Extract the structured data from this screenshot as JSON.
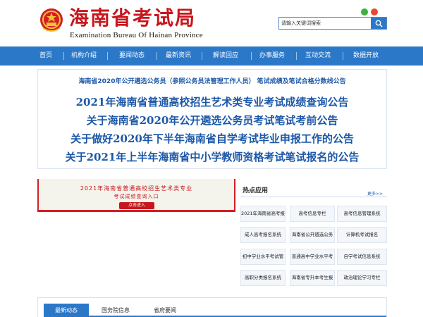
{
  "header": {
    "title": "海南省考试局",
    "subtitle": "Examination Bureau Of Hainan Province",
    "top_links": [
      "",
      ""
    ],
    "search": {
      "placeholder": "请输入关键词搜索"
    }
  },
  "nav": {
    "items": [
      {
        "label": "首页"
      },
      {
        "label": "机构介绍"
      },
      {
        "label": "要闻动态"
      },
      {
        "label": "最新资讯"
      },
      {
        "label": "解读回应"
      },
      {
        "label": "办事服务"
      },
      {
        "label": "互动交流"
      },
      {
        "label": "数据开放"
      }
    ]
  },
  "headlines": {
    "sub": "海南省2020年公开遴选公务员（参照公务员法管理工作人员） 笔试成绩及笔试合格分数线公告",
    "items": [
      {
        "text": "2021年海南省普通高校招生艺术类专业考试成绩查询公告"
      },
      {
        "text": "关于海南省2020年公开遴选公务员考试笔试考前公告"
      },
      {
        "text": "关于做好2020年下半年海南省自学考试毕业申报工作的公告"
      },
      {
        "text": "关于2021年上半年海南省中小学教师资格考试笔试报名的公告"
      }
    ]
  },
  "banner": {
    "line1": "2021年海南省普通高校招生艺术类专业",
    "line2": "考试成绩查询入口",
    "button": "点击进入"
  },
  "hot_apps": {
    "title": "热点应用",
    "more": "更多>>",
    "tiles": [
      {
        "label": "2021年海南省高考报"
      },
      {
        "label": "高考信息专栏"
      },
      {
        "label": "高考信息管理系统"
      },
      {
        "label": "成人高考报名系统"
      },
      {
        "label": "海南省公开遴选公务"
      },
      {
        "label": "计算机考试报名"
      },
      {
        "label": "初中学业水平考试管"
      },
      {
        "label": "普通高中学业水平考"
      },
      {
        "label": "自学考试信息系统"
      },
      {
        "label": "高职分类报名系统"
      },
      {
        "label": "海南省专升本考生报"
      },
      {
        "label": "政治理论学习专栏"
      }
    ]
  },
  "tabs": {
    "items": [
      {
        "label": "最新动态"
      },
      {
        "label": "国务院信息"
      },
      {
        "label": "省府要闻"
      }
    ]
  },
  "colors": {
    "brand_red": "#c8161d",
    "nav_blue": "#2b78c9",
    "headline_blue": "#1c58a8"
  }
}
